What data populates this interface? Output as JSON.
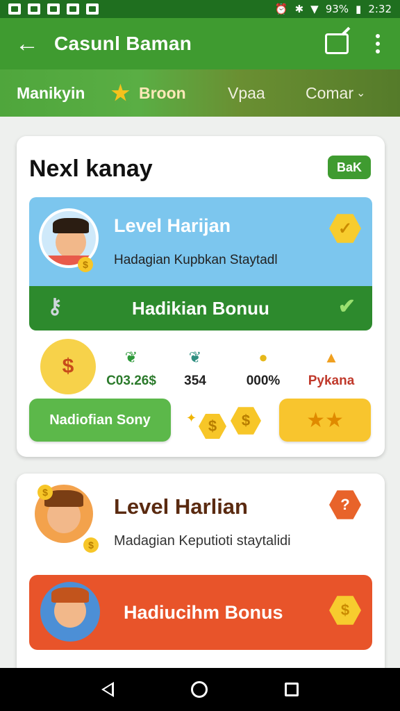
{
  "status_bar": {
    "battery": "93%",
    "time": "2:32"
  },
  "app_bar": {
    "title": "Casunl Baman",
    "back_icon": "arrow-left-icon"
  },
  "tabs": [
    {
      "label": "Manikyin"
    },
    {
      "label": "Broon"
    },
    {
      "label": "Vpaa"
    },
    {
      "label": "Comar"
    }
  ],
  "card1": {
    "title": "Nexl kanay",
    "back_label": "BaK",
    "level_title": "Level Harijan",
    "level_sub": "Hadagian Kupbkan Staytadl",
    "bonus_label": "Hadikian Bonuu",
    "stats": [
      {
        "value": "C03.26$",
        "icon": "leaf-icon"
      },
      {
        "value": "354",
        "icon": "leaf-icon"
      },
      {
        "value": "000%",
        "icon": "coin-icon"
      },
      {
        "value": "Pykana",
        "icon": "chest-icon"
      }
    ],
    "green_button": "Nadiofian Sony"
  },
  "card2": {
    "level_title": "Level Harlian",
    "level_sub": "Madagian Keputioti staytalidi",
    "bonus_label": "Hadiucihm Bonus"
  },
  "colors": {
    "primary": "#3f9b30",
    "accent": "#f8c52e",
    "danger": "#e8542a",
    "panel": "#7cc6ee"
  }
}
